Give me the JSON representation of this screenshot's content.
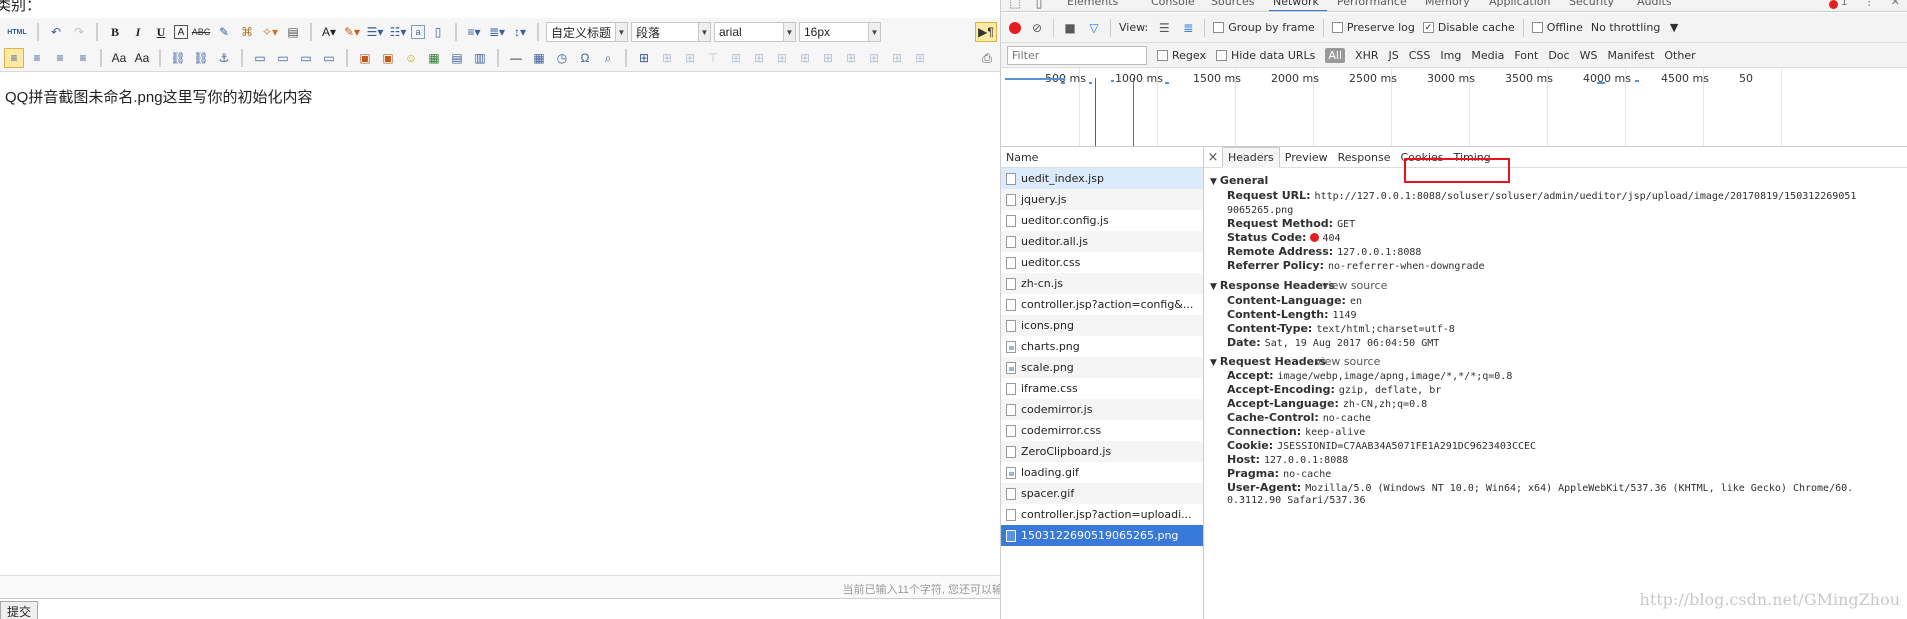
{
  "editor": {
    "category_label": "类别：",
    "content_text": "QQ拼音截图未命名.png这里写你的初始化内容",
    "word_count": "当前已输入11个字符, 您还可以输",
    "submit_label": "提交",
    "toolbar": {
      "html_label": "HTML",
      "bold_label": "B",
      "italic_label": "I",
      "underline_label": "U",
      "custom_style_value": "自定义标题",
      "paragraph_value": "段落",
      "font_family_value": "arial",
      "font_size_value": "16px"
    }
  },
  "devtools": {
    "tabs": [
      "Elements",
      "Console",
      "Sources",
      "Network",
      "Performance",
      "Memory",
      "Application",
      "Security",
      "Audits"
    ],
    "selected_tab": "Network",
    "error_count": "1",
    "toolbar": {
      "view_label": "View:",
      "group_by_frame": "Group by frame",
      "preserve_log": "Preserve log",
      "disable_cache": "Disable cache",
      "offline": "Offline",
      "throttling": "No throttling"
    },
    "filter": {
      "placeholder": "Filter",
      "regex": "Regex",
      "hide_data_urls": "Hide data URLs",
      "types": [
        "All",
        "XHR",
        "JS",
        "CSS",
        "Img",
        "Media",
        "Font",
        "Doc",
        "WS",
        "Manifest",
        "Other"
      ]
    },
    "timeline_ticks": [
      "500 ms",
      "1000 ms",
      "1500 ms",
      "2000 ms",
      "2500 ms",
      "3000 ms",
      "3500 ms",
      "4000 ms",
      "4500 ms",
      "50"
    ],
    "name_header": "Name",
    "requests": [
      {
        "name": "uedit_index.jsp",
        "icon": "doc-icon"
      },
      {
        "name": "jquery.js",
        "icon": "doc-icon"
      },
      {
        "name": "ueditor.config.js",
        "icon": "doc-icon"
      },
      {
        "name": "ueditor.all.js",
        "icon": "doc-icon"
      },
      {
        "name": "ueditor.css",
        "icon": "doc-icon"
      },
      {
        "name": "zh-cn.js",
        "icon": "doc-icon"
      },
      {
        "name": "controller.jsp?action=config&...",
        "icon": "doc-icon"
      },
      {
        "name": "icons.png",
        "icon": "doc-icon"
      },
      {
        "name": "charts.png",
        "icon": "image-icon"
      },
      {
        "name": "scale.png",
        "icon": "image-icon"
      },
      {
        "name": "iframe.css",
        "icon": "doc-icon"
      },
      {
        "name": "codemirror.js",
        "icon": "doc-icon"
      },
      {
        "name": "codemirror.css",
        "icon": "doc-icon"
      },
      {
        "name": "ZeroClipboard.js",
        "icon": "doc-icon"
      },
      {
        "name": "loading.gif",
        "icon": "image-icon"
      },
      {
        "name": "spacer.gif",
        "icon": "doc-icon"
      },
      {
        "name": "controller.jsp?action=uploadi...",
        "icon": "doc-icon"
      },
      {
        "name": "1503122690519065265.png",
        "icon": "doc-icon"
      }
    ],
    "detail_tabs": [
      "Headers",
      "Preview",
      "Response",
      "Cookies",
      "Timing"
    ],
    "general": {
      "title": "General",
      "request_url_key": "Request URL:",
      "request_url_line1": "http://127.0.0.1:8088/soluser/soluser/admin/ueditor/jsp/upload/image/20170819/150312269051",
      "request_url_line2": "9065265.png",
      "method_key": "Request Method:",
      "method": "GET",
      "status_key": "Status Code:",
      "status": "404",
      "remote_key": "Remote Address:",
      "remote": "127.0.0.1:8088",
      "referrer_key": "Referrer Policy:",
      "referrer": "no-referrer-when-downgrade"
    },
    "response_headers": {
      "title": "Response Headers",
      "view_source": "view source",
      "rows": [
        {
          "k": "Content-Language:",
          "v": "en"
        },
        {
          "k": "Content-Length:",
          "v": "1149"
        },
        {
          "k": "Content-Type:",
          "v": "text/html;charset=utf-8"
        },
        {
          "k": "Date:",
          "v": "Sat, 19 Aug 2017 06:04:50 GMT"
        }
      ]
    },
    "request_headers": {
      "title": "Request Headers",
      "view_source": "view source",
      "rows": [
        {
          "k": "Accept:",
          "v": "image/webp,image/apng,image/*,*/*;q=0.8"
        },
        {
          "k": "Accept-Encoding:",
          "v": "gzip, deflate, br"
        },
        {
          "k": "Accept-Language:",
          "v": "zh-CN,zh;q=0.8"
        },
        {
          "k": "Cache-Control:",
          "v": "no-cache"
        },
        {
          "k": "Connection:",
          "v": "keep-alive"
        },
        {
          "k": "Cookie:",
          "v": "JSESSIONID=C7AAB34A5071FE1A291DC9623403CCEC"
        },
        {
          "k": "Host:",
          "v": "127.0.0.1:8088"
        },
        {
          "k": "Pragma:",
          "v": "no-cache"
        },
        {
          "k": "User-Agent:",
          "v": "Mozilla/5.0 (Windows NT 10.0; Win64; x64) AppleWebKit/537.36 (KHTML, like Gecko) Chrome/60."
        }
      ],
      "user_agent_cont": "0.3112.90 Safari/537.36"
    },
    "watermark": "http://blog.csdn.net/GMingZhou"
  }
}
